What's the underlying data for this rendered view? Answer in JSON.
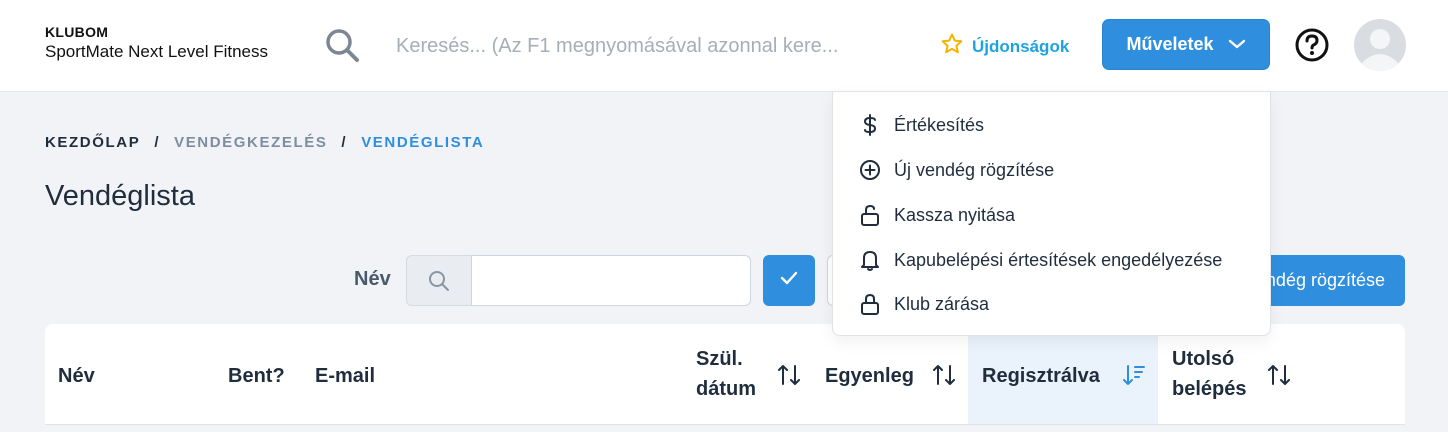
{
  "header": {
    "club_caption": "KLUBOM",
    "club_name": "SportMate Next Level Fitness",
    "search_placeholder": "Keresés... (Az F1 megnyomásával azonnal kere...",
    "news_label": "Újdonságok",
    "actions_label": "Műveletek"
  },
  "breadcrumb": {
    "home": "KEZDŐLAP",
    "separator": "/",
    "section": "VENDÉGKEZELÉS",
    "current": "VENDÉGLISTA"
  },
  "page_title": "Vendéglista",
  "filter": {
    "name_label": "Név",
    "name_value": "",
    "new_guest_label": "Új vendég rögzítése"
  },
  "table": {
    "columns": {
      "name": "Név",
      "inside": "Bent?",
      "email": "E-mail",
      "birth_line1": "Szül.",
      "birth_line2": "dátum",
      "balance": "Egyenleg",
      "registered": "Regisztrálva",
      "last_line1": "Utolsó",
      "last_line2": "belépés"
    },
    "sorted_column": "registered"
  },
  "actions_menu": {
    "items": [
      {
        "label": "Értékesítés",
        "icon": "dollar-icon"
      },
      {
        "label": "Új vendég rögzítése",
        "icon": "plus-circle-icon"
      },
      {
        "label": "Kassza nyitása",
        "icon": "unlock-icon"
      },
      {
        "label": "Kapubelépési értesítések engedélyezése",
        "icon": "bell-icon"
      },
      {
        "label": "Klub zárása",
        "icon": "lock-icon"
      }
    ]
  },
  "colors": {
    "primary": "#2f8fde",
    "news": "#1fa3e0",
    "star": "#f5b400",
    "text": "#1f2d3d"
  }
}
